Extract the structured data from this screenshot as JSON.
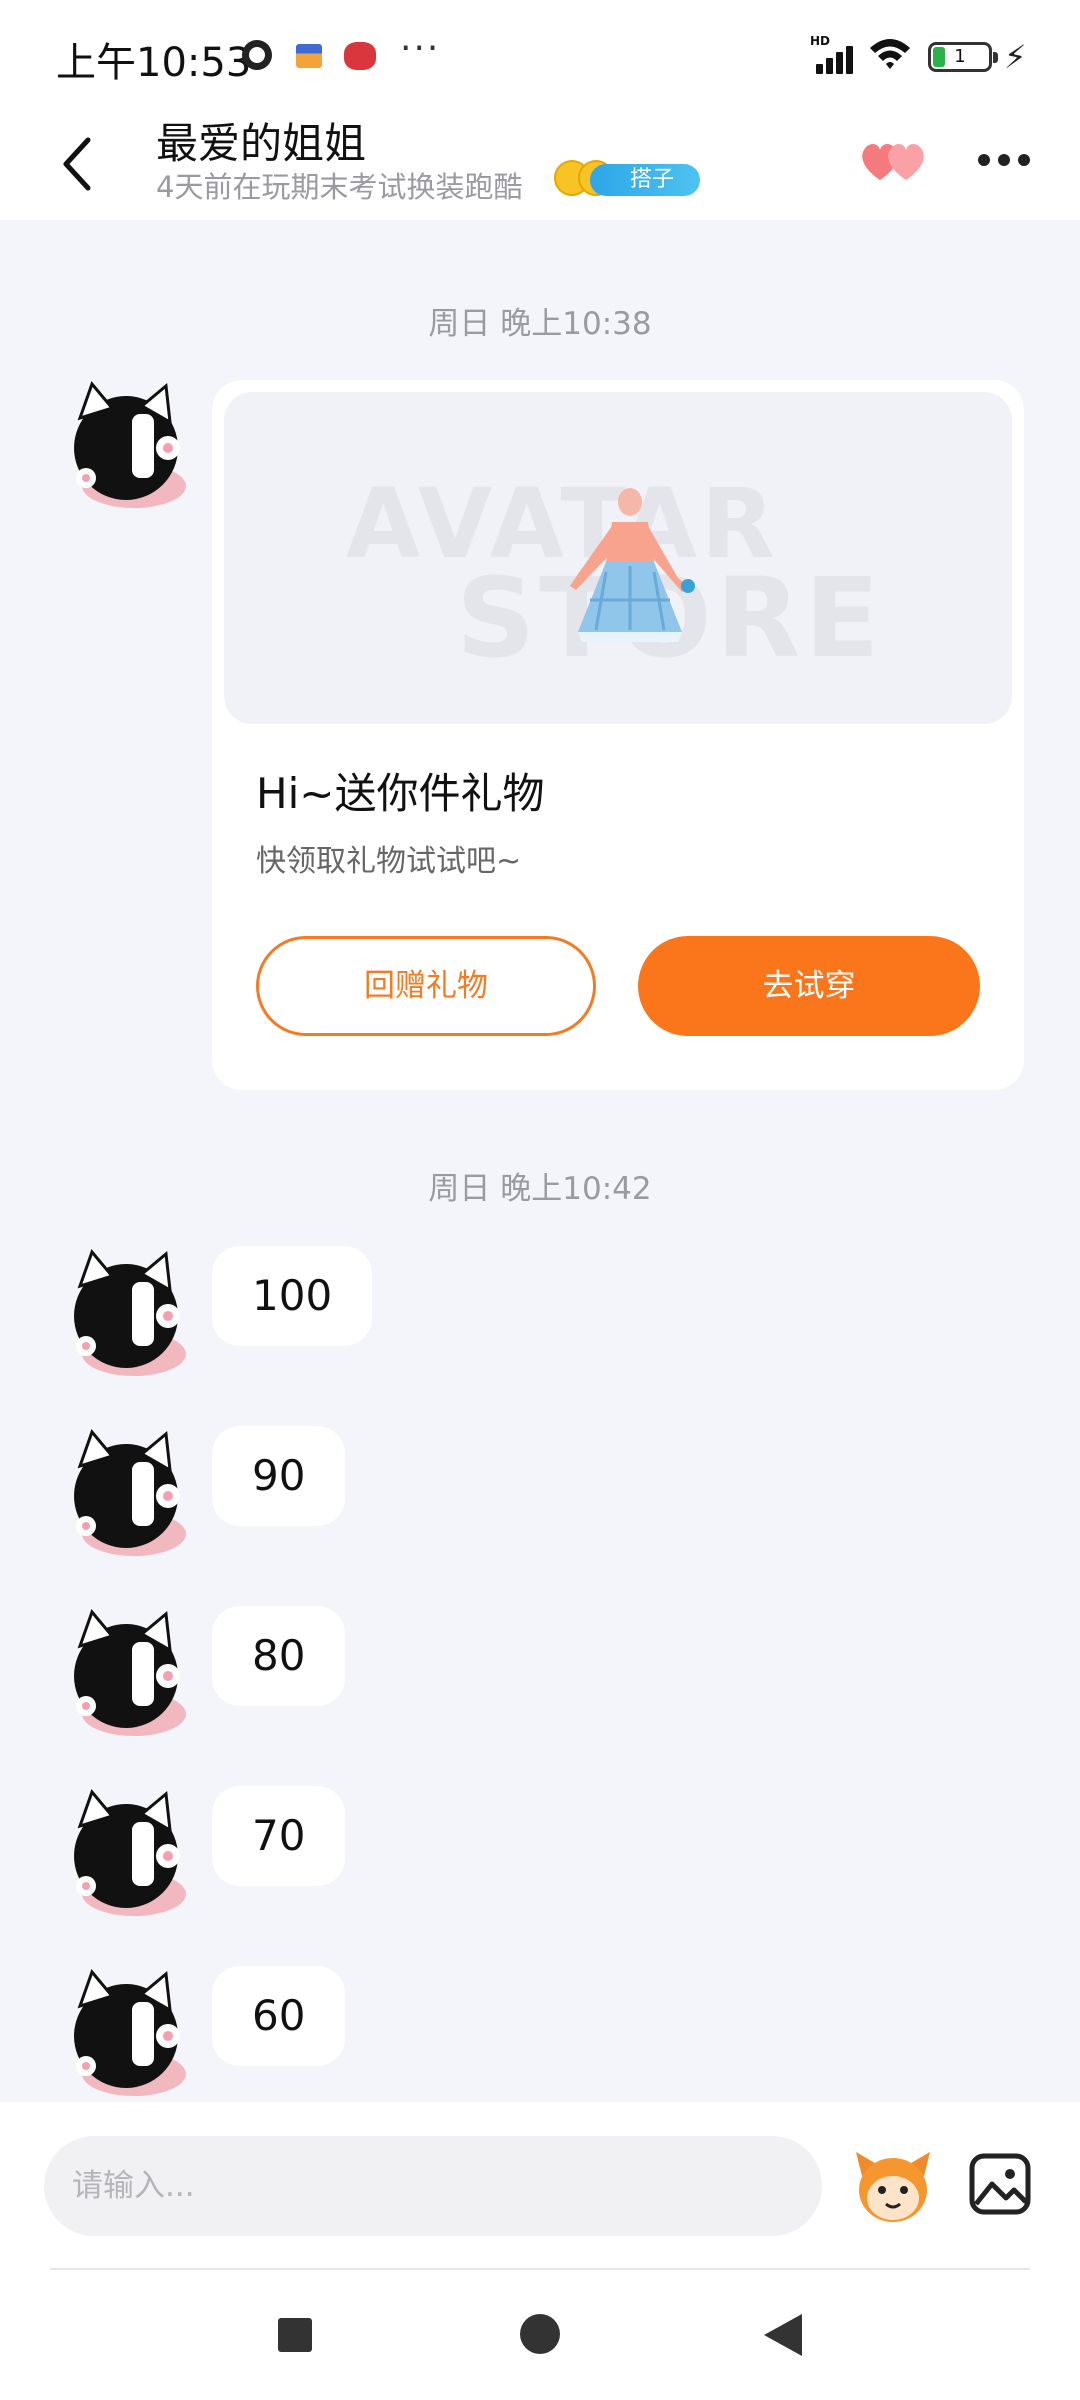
{
  "status_bar": {
    "time": "上午10:53",
    "dots": "···",
    "network": "HD",
    "battery_level": "1",
    "icons": [
      "notification-icon-1",
      "notification-icon-2",
      "notification-icon-3",
      "signal-icon",
      "wifi-icon",
      "battery-icon",
      "charging-icon"
    ]
  },
  "header": {
    "title": "最爱的姐姐",
    "subtitle": "4天前在玩期末考试换装跑酷",
    "tag": "搭子",
    "colors": {
      "tag_bg": "#35aeea",
      "heart": "#f47a7e"
    }
  },
  "messages": {
    "timestamp_1": "周日 晚上10:38",
    "gift_card": {
      "watermark_line1": "AVATAR",
      "watermark_line2": "STORE",
      "title": "Hi~送你件礼物",
      "description": "快领取礼物试试吧~",
      "return_gift_label": "回赠礼物",
      "try_on_label": "去试穿"
    },
    "timestamp_2": "周日 晚上10:42",
    "bubbles": [
      "100",
      "90",
      "80",
      "70",
      "60"
    ]
  },
  "input": {
    "placeholder": "请输入..."
  },
  "colors": {
    "accent": "#fb761b",
    "background": "#f4f5fa"
  }
}
